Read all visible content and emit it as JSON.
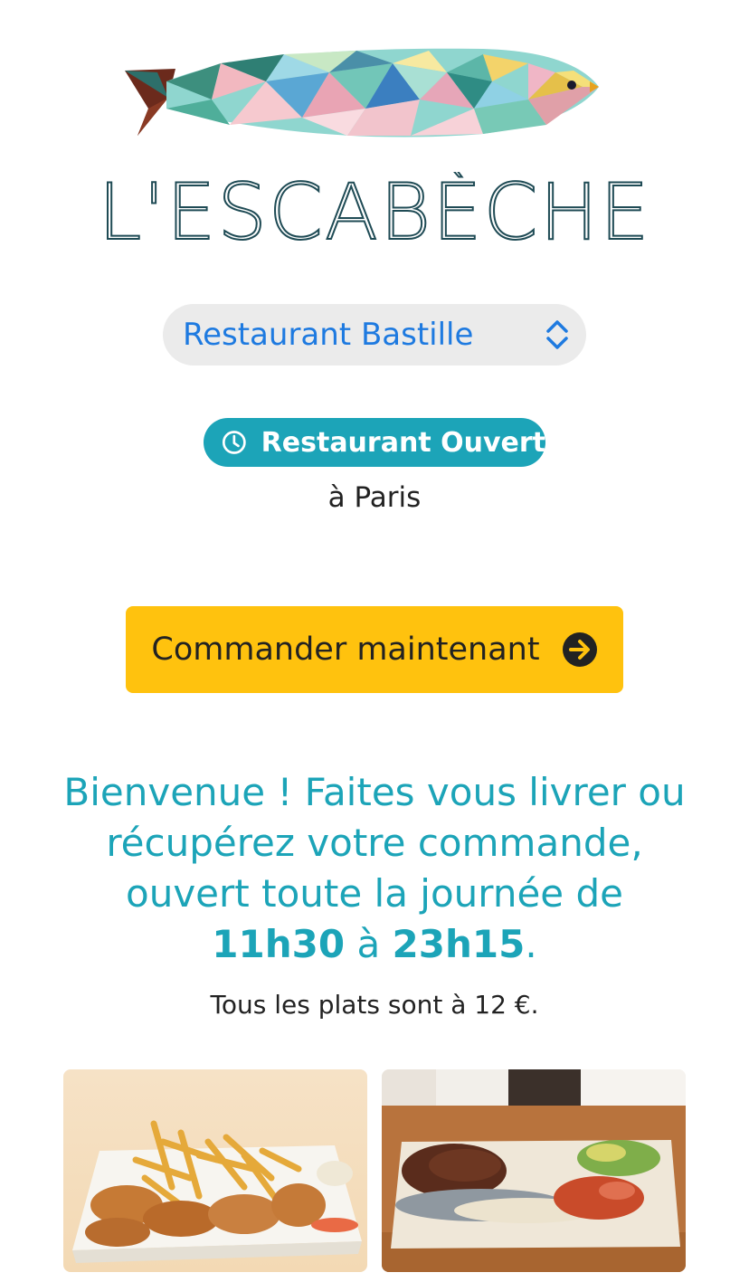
{
  "brand": {
    "name": "L'ESCABÈCHE"
  },
  "restaurant_select": {
    "selected": "Restaurant Bastille"
  },
  "status": {
    "label": "Restaurant Ouvert",
    "city": "à Paris"
  },
  "order_button": {
    "label": "Commander maintenant"
  },
  "welcome": {
    "line_prefix": "Bienvenue ! Faites vous livrer ou récupérez votre commande, ouvert toute la journée de ",
    "open_time": "11h30",
    "between": " à ",
    "close_time": "23h15",
    "suffix": "."
  },
  "price_note": "Tous les plats sont à 12 €.",
  "colors": {
    "accent": "#1ca4b8",
    "button": "#ffc20e",
    "select_text": "#1e7ae0"
  },
  "icons": {
    "select": "chevron-up-down-icon",
    "status": "clock-icon",
    "order": "arrow-circle-right-icon"
  }
}
